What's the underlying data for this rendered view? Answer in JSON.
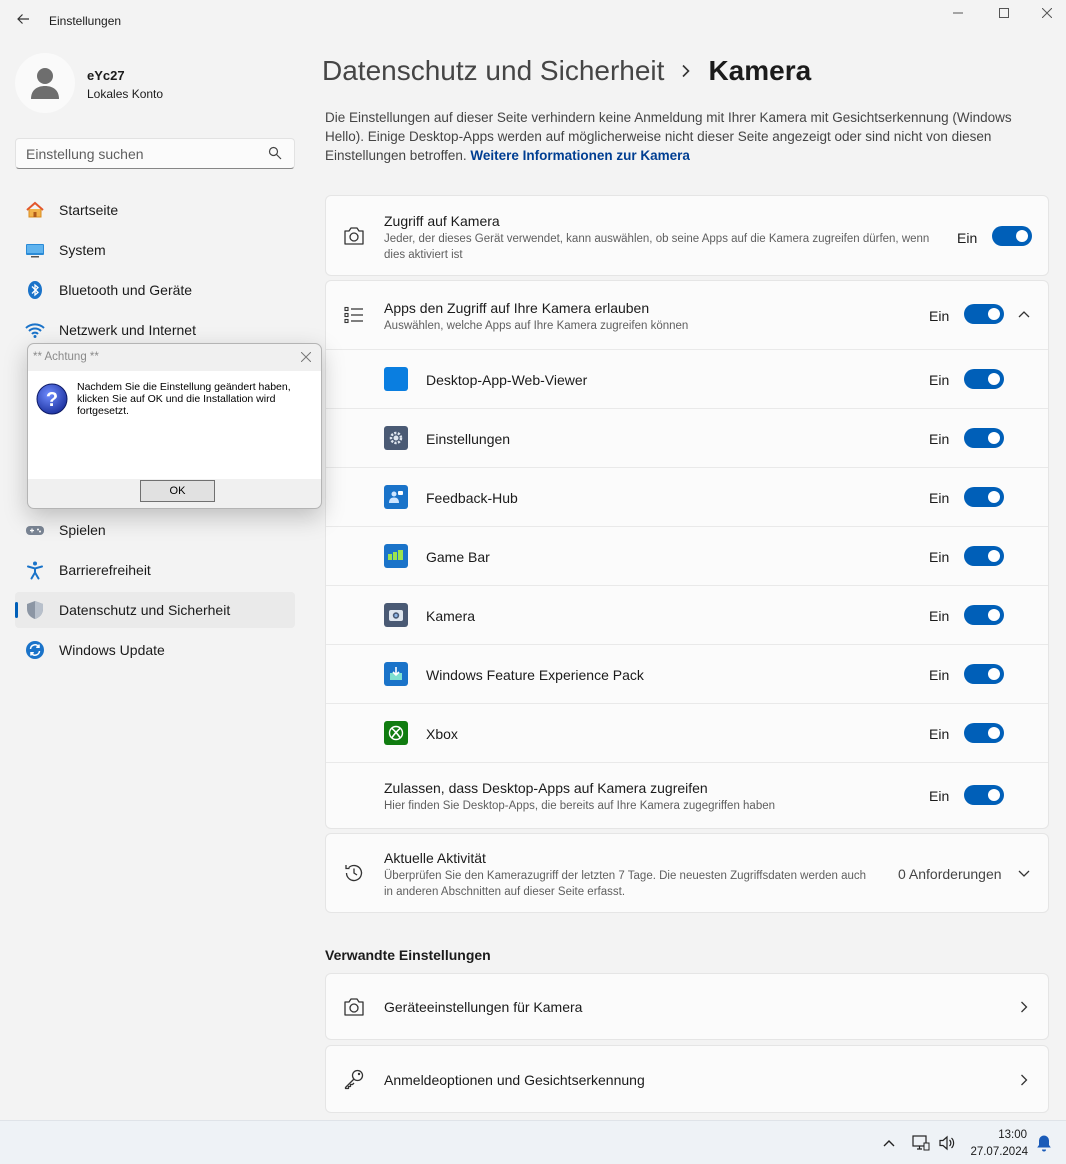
{
  "window": {
    "title": "Einstellungen"
  },
  "account": {
    "name": "eYc27",
    "type": "Lokales Konto"
  },
  "search": {
    "placeholder": "Einstellung suchen"
  },
  "nav": {
    "items": [
      {
        "label": "Startseite",
        "icon": "home-icon"
      },
      {
        "label": "System",
        "icon": "monitor-icon"
      },
      {
        "label": "Bluetooth und Geräte",
        "icon": "bluetooth-icon"
      },
      {
        "label": "Netzwerk und Internet",
        "icon": "wifi-icon"
      },
      {
        "label": "Spielen",
        "icon": "gamepad-icon"
      },
      {
        "label": "Barrierefreiheit",
        "icon": "accessibility-icon"
      },
      {
        "label": "Datenschutz und Sicherheit",
        "icon": "shield-icon"
      },
      {
        "label": "Windows Update",
        "icon": "update-icon"
      }
    ],
    "active": "Datenschutz und Sicherheit"
  },
  "header": {
    "parent": "Datenschutz und Sicherheit",
    "current": "Kamera"
  },
  "intro": {
    "text": "Die Einstellungen auf dieser Seite verhindern keine Anmeldung mit Ihrer Kamera mit Gesichtserkennung (Windows Hello). Einige Desktop-Apps werden auf möglicherweise nicht dieser Seite angezeigt oder sind nicht von diesen Einstellungen betroffen.",
    "link": "Weitere Informationen zur Kamera"
  },
  "camera_access": {
    "title": "Zugriff auf Kamera",
    "description": "Jeder, der dieses Gerät verwendet, kann auswählen, ob seine Apps auf die Kamera zugreifen dürfen, wenn dies aktiviert ist",
    "state": "Ein"
  },
  "apps_access": {
    "title": "Apps den Zugriff auf Ihre Kamera erlauben",
    "description": "Auswählen, welche Apps auf Ihre Kamera zugreifen können",
    "state": "Ein",
    "apps": [
      {
        "name": "Desktop-App-Web-Viewer",
        "state": "Ein",
        "color": "#0a7ee0"
      },
      {
        "name": "Einstellungen",
        "state": "Ein",
        "color": "#4a5a74"
      },
      {
        "name": "Feedback-Hub",
        "state": "Ein",
        "color": "#1a73c9"
      },
      {
        "name": "Game Bar",
        "state": "Ein",
        "color": "#1a73c9"
      },
      {
        "name": "Kamera",
        "state": "Ein",
        "color": "#4a5a74"
      },
      {
        "name": "Windows Feature Experience Pack",
        "state": "Ein",
        "color": "#1a73c9"
      },
      {
        "name": "Xbox",
        "state": "Ein",
        "color": "#107c10"
      }
    ],
    "desktop": {
      "title": "Zulassen, dass Desktop-Apps auf Kamera zugreifen",
      "description": "Hier finden Sie Desktop-Apps, die bereits auf Ihre Kamera zugegriffen haben",
      "state": "Ein"
    }
  },
  "activity": {
    "title": "Aktuelle Aktivität",
    "description": "Überprüfen Sie den Kamerazugriff der letzten 7 Tage. Die neuesten Zugriffsdaten werden auch in anderen Abschnitten auf dieser Seite erfasst.",
    "count": "0 Anforderungen"
  },
  "related": {
    "title": "Verwandte Einstellungen",
    "items": [
      {
        "label": "Geräteeinstellungen für Kamera"
      },
      {
        "label": "Anmeldeoptionen und Gesichtserkennung"
      }
    ]
  },
  "dialog": {
    "title": "** Achtung **",
    "message": "Nachdem Sie die Einstellung geändert haben, klicken Sie auf OK und die Installation wird fortgesetzt.",
    "ok": "OK"
  },
  "taskbar": {
    "time": "13:00",
    "date": "27.07.2024"
  },
  "colors": {
    "accent": "#005fb8",
    "link": "#003e92",
    "background": "#f3f3f3"
  }
}
